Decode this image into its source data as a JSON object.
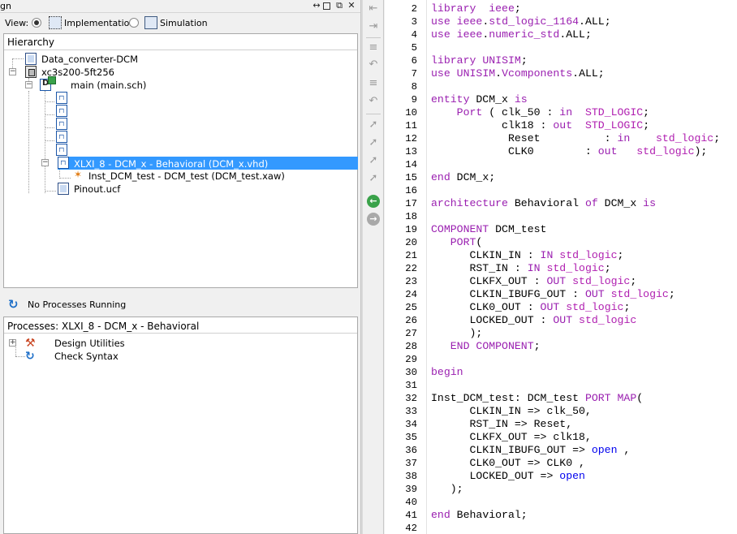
{
  "left_panel": {
    "design_title": "gn",
    "view": {
      "label": "View:",
      "options": [
        "Implementation",
        "Simulation"
      ],
      "selected": "Implementation"
    },
    "hierarchy": {
      "title": "Hierarchy",
      "items": [
        {
          "label": "Data_converter-DCM"
        },
        {
          "label": "xc3s200-5ft256"
        },
        {
          "label": "main (main.sch)"
        },
        {
          "label": ""
        },
        {
          "label": ""
        },
        {
          "label": ""
        },
        {
          "label": ""
        },
        {
          "label": "XLXI_8 - DCM_x - Behavioral (DCM_x.vhd)",
          "selected": true
        },
        {
          "label": "Inst_DCM_test - DCM_test (DCM_test.xaw)"
        },
        {
          "label": "Pinout.ucf"
        }
      ]
    },
    "status": "No Processes Running",
    "processes": {
      "title": "Processes: XLXI_8 - DCM_x - Behavioral",
      "items": [
        {
          "label": "Design Utilities"
        },
        {
          "label": "Check Syntax"
        }
      ]
    }
  },
  "editor": {
    "lines": [
      {
        "n": 2,
        "tokens": [
          [
            "kw",
            "library"
          ],
          [
            "",
            "  "
          ],
          [
            "kw",
            "ieee"
          ],
          [
            "",
            ";"
          ]
        ]
      },
      {
        "n": 3,
        "tokens": [
          [
            "kw",
            "use"
          ],
          [
            "",
            " "
          ],
          [
            "kw",
            "ieee"
          ],
          [
            "",
            "."
          ],
          [
            "kw",
            "std_logic_1164"
          ],
          [
            "",
            "."
          ],
          [
            "",
            "ALL;"
          ]
        ]
      },
      {
        "n": 4,
        "tokens": [
          [
            "kw",
            "use"
          ],
          [
            "",
            " "
          ],
          [
            "kw",
            "ieee"
          ],
          [
            "",
            "."
          ],
          [
            "kw",
            "numeric_std"
          ],
          [
            "",
            "."
          ],
          [
            "",
            "ALL;"
          ]
        ]
      },
      {
        "n": 5,
        "tokens": []
      },
      {
        "n": 6,
        "tokens": [
          [
            "kw",
            "library"
          ],
          [
            "",
            " "
          ],
          [
            "kw",
            "UNISIM"
          ],
          [
            "",
            ";"
          ]
        ]
      },
      {
        "n": 7,
        "tokens": [
          [
            "kw",
            "use"
          ],
          [
            "",
            " "
          ],
          [
            "kw",
            "UNISIM"
          ],
          [
            "",
            "."
          ],
          [
            "kw",
            "Vcomponents"
          ],
          [
            "",
            "."
          ],
          [
            "",
            "ALL;"
          ]
        ]
      },
      {
        "n": 8,
        "tokens": []
      },
      {
        "n": 9,
        "tokens": [
          [
            "kw",
            "entity"
          ],
          [
            "",
            " DCM_x "
          ],
          [
            "kw",
            "is"
          ]
        ]
      },
      {
        "n": 10,
        "tokens": [
          [
            "",
            "    "
          ],
          [
            "kw",
            "Port"
          ],
          [
            "",
            " ( clk_50 : "
          ],
          [
            "kw",
            "in"
          ],
          [
            "",
            "  "
          ],
          [
            "ty",
            "STD_LOGIC"
          ],
          [
            "",
            ";"
          ]
        ]
      },
      {
        "n": 11,
        "tokens": [
          [
            "",
            "           clk18 : "
          ],
          [
            "kw",
            "out"
          ],
          [
            "",
            "  "
          ],
          [
            "ty",
            "STD_LOGIC"
          ],
          [
            "",
            ";"
          ]
        ]
      },
      {
        "n": 12,
        "tokens": [
          [
            "",
            "            Reset          : "
          ],
          [
            "kw",
            "in"
          ],
          [
            "",
            "    "
          ],
          [
            "ty",
            "std_logic"
          ],
          [
            "",
            ";"
          ]
        ]
      },
      {
        "n": 13,
        "tokens": [
          [
            "",
            "            CLK0        : "
          ],
          [
            "kw",
            "out"
          ],
          [
            "",
            "   "
          ],
          [
            "ty",
            "std_logic"
          ],
          [
            "",
            ");"
          ]
        ]
      },
      {
        "n": 14,
        "tokens": []
      },
      {
        "n": 15,
        "tokens": [
          [
            "kw",
            "end"
          ],
          [
            "",
            " DCM_x;"
          ]
        ]
      },
      {
        "n": 16,
        "tokens": []
      },
      {
        "n": 17,
        "tokens": [
          [
            "kw",
            "architecture"
          ],
          [
            "",
            " Behavioral "
          ],
          [
            "kw",
            "of"
          ],
          [
            "",
            " DCM_x "
          ],
          [
            "kw",
            "is"
          ]
        ]
      },
      {
        "n": 18,
        "tokens": []
      },
      {
        "n": 19,
        "tokens": [
          [
            "kw",
            "COMPONENT"
          ],
          [
            "",
            " DCM_test"
          ]
        ]
      },
      {
        "n": 20,
        "tokens": [
          [
            "",
            "   "
          ],
          [
            "kw",
            "PORT"
          ],
          [
            "",
            "("
          ]
        ]
      },
      {
        "n": 21,
        "tokens": [
          [
            "",
            "      CLKIN_IN : "
          ],
          [
            "kw",
            "IN"
          ],
          [
            "",
            " "
          ],
          [
            "ty",
            "std_logic"
          ],
          [
            "",
            ";"
          ]
        ]
      },
      {
        "n": 22,
        "tokens": [
          [
            "",
            "      RST_IN : "
          ],
          [
            "kw",
            "IN"
          ],
          [
            "",
            " "
          ],
          [
            "ty",
            "std_logic"
          ],
          [
            "",
            ";"
          ]
        ]
      },
      {
        "n": 23,
        "tokens": [
          [
            "",
            "      CLKFX_OUT : "
          ],
          [
            "kw",
            "OUT"
          ],
          [
            "",
            " "
          ],
          [
            "ty",
            "std_logic"
          ],
          [
            "",
            ";"
          ]
        ]
      },
      {
        "n": 24,
        "tokens": [
          [
            "",
            "      CLKIN_IBUFG_OUT : "
          ],
          [
            "kw",
            "OUT"
          ],
          [
            "",
            " "
          ],
          [
            "ty",
            "std_logic"
          ],
          [
            "",
            ";"
          ]
        ]
      },
      {
        "n": 25,
        "tokens": [
          [
            "",
            "      CLK0_OUT : "
          ],
          [
            "kw",
            "OUT"
          ],
          [
            "",
            " "
          ],
          [
            "ty",
            "std_logic"
          ],
          [
            "",
            ";"
          ]
        ]
      },
      {
        "n": 26,
        "tokens": [
          [
            "",
            "      LOCKED_OUT : "
          ],
          [
            "kw",
            "OUT"
          ],
          [
            "",
            " "
          ],
          [
            "ty",
            "std_logic"
          ]
        ]
      },
      {
        "n": 27,
        "tokens": [
          [
            "",
            "      );"
          ]
        ]
      },
      {
        "n": 28,
        "tokens": [
          [
            "",
            "   "
          ],
          [
            "kw",
            "END COMPONENT"
          ],
          [
            "",
            ";"
          ]
        ]
      },
      {
        "n": 29,
        "tokens": []
      },
      {
        "n": 30,
        "tokens": [
          [
            "kw",
            "begin"
          ]
        ]
      },
      {
        "n": 31,
        "tokens": []
      },
      {
        "n": 32,
        "tokens": [
          [
            "",
            "Inst_DCM_test: DCM_test "
          ],
          [
            "kw",
            "PORT MAP"
          ],
          [
            "",
            "("
          ]
        ]
      },
      {
        "n": 33,
        "tokens": [
          [
            "",
            "      CLKIN_IN => clk_50,"
          ]
        ]
      },
      {
        "n": 34,
        "tokens": [
          [
            "",
            "      RST_IN => Reset,"
          ]
        ]
      },
      {
        "n": 35,
        "tokens": [
          [
            "",
            "      CLKFX_OUT => clk18,"
          ]
        ]
      },
      {
        "n": 36,
        "tokens": [
          [
            "",
            "      CLKIN_IBUFG_OUT => "
          ],
          [
            "bl",
            "open"
          ],
          [
            "",
            " ,"
          ]
        ]
      },
      {
        "n": 37,
        "tokens": [
          [
            "",
            "      CLK0_OUT => CLK0 ,"
          ]
        ]
      },
      {
        "n": 38,
        "tokens": [
          [
            "",
            "      LOCKED_OUT => "
          ],
          [
            "bl",
            "open"
          ]
        ]
      },
      {
        "n": 39,
        "tokens": [
          [
            "",
            "   );"
          ]
        ]
      },
      {
        "n": 40,
        "tokens": []
      },
      {
        "n": 41,
        "tokens": [
          [
            "kw",
            "end"
          ],
          [
            "",
            " Behavioral;"
          ]
        ]
      },
      {
        "n": 42,
        "tokens": []
      }
    ]
  },
  "colors": {
    "keyword": "#9a1fb0",
    "type": "#b01fb0",
    "open_keyword": "#0000ee",
    "selection": "#3399ff"
  }
}
